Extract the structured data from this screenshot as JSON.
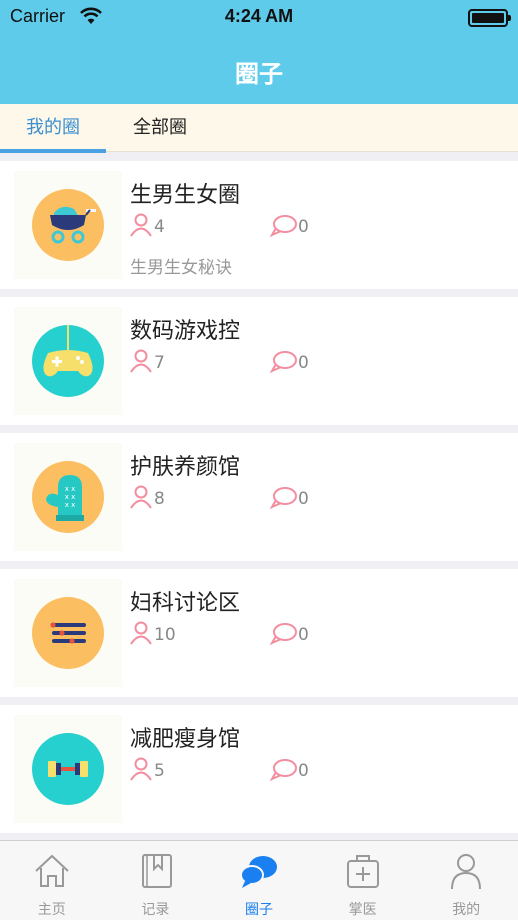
{
  "status_bar": {
    "carrier": "Carrier",
    "time": "4:24 AM"
  },
  "header": {
    "title": "圈子"
  },
  "segment_tabs": [
    {
      "label": "我的圈",
      "active": true
    },
    {
      "label": "全部圈",
      "active": false
    }
  ],
  "circles": [
    {
      "name": "生男生女圈",
      "members": "4",
      "posts": "0",
      "description": "生男生女秘诀",
      "icon": "baby-stroller-icon",
      "icon_bg": "#fbbf62"
    },
    {
      "name": "数码游戏控",
      "members": "7",
      "posts": "0",
      "description": "",
      "icon": "gamepad-icon",
      "icon_bg": "#26d0ce"
    },
    {
      "name": "护肤养颜馆",
      "members": "8",
      "posts": "0",
      "description": "",
      "icon": "mitten-icon",
      "icon_bg": "#fbbf62"
    },
    {
      "name": "妇科讨论区",
      "members": "10",
      "posts": "0",
      "description": "",
      "icon": "list-icon",
      "icon_bg": "#fbbf62"
    },
    {
      "name": "减肥瘦身馆",
      "members": "5",
      "posts": "0",
      "description": "",
      "icon": "dumbbell-icon",
      "icon_bg": "#26d0ce"
    }
  ],
  "tab_bar": [
    {
      "label": "主页",
      "icon": "home-icon",
      "active": false
    },
    {
      "label": "记录",
      "icon": "notebook-icon",
      "active": false
    },
    {
      "label": "圈子",
      "icon": "chat-bubbles-icon",
      "active": true
    },
    {
      "label": "掌医",
      "icon": "medical-kit-icon",
      "active": false
    },
    {
      "label": "我的",
      "icon": "person-icon",
      "active": false
    }
  ],
  "colors": {
    "nav": "#5ecbea",
    "accent": "#1a7ff0",
    "segment_bg": "#fdf8ea",
    "stat_icon": "#f28ea0"
  }
}
